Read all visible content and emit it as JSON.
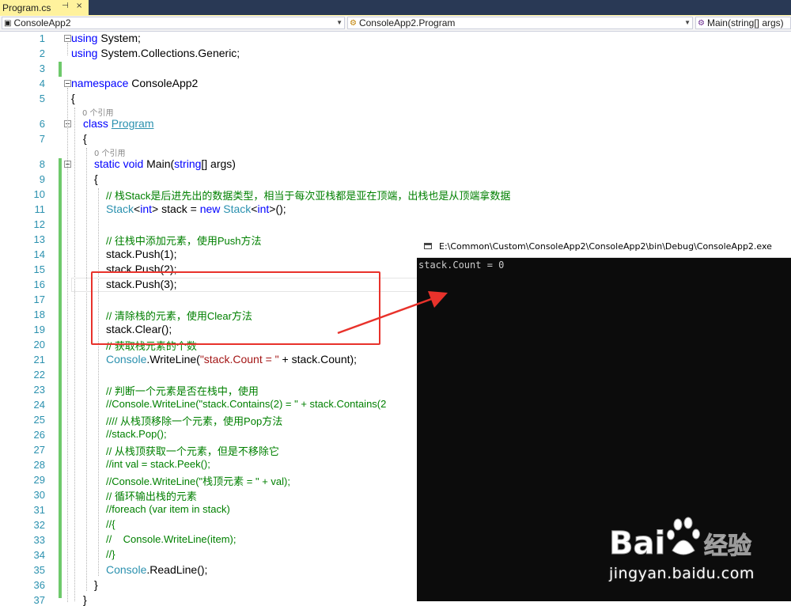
{
  "tab": {
    "title": "Program.cs",
    "pin": "⊣",
    "close": "×"
  },
  "nav": {
    "project": "ConsoleApp2",
    "class": "ConsoleApp2.Program",
    "member": "Main(string[] args)"
  },
  "codelens": {
    "refs": "0 个引用"
  },
  "lines": [
    "using System;",
    "using System.Collections.Generic;",
    "",
    "namespace ConsoleApp2",
    "{",
    "class Program",
    "{",
    "static void Main(string[] args)",
    "{",
    "// 栈Stack是后进先出的数据类型，相当于每次亚栈都是亚在顶端，出栈也是从顶端拿数据",
    "Stack<int> stack = new Stack<int>();",
    "",
    "// 往栈中添加元素，使用Push方法",
    "stack.Push(1);",
    "stack.Push(2);",
    "stack.Push(3);",
    "",
    "// 清除栈的元素，使用Clear方法",
    "stack.Clear();",
    "// 获取栈元素的个数",
    "Console.WriteLine(\"stack.Count = \" + stack.Count);",
    "",
    "// 判断一个元素是否在栈中，使用",
    "//Console.WriteLine(\"stack.Contains(2) = \" + stack.Contains(2",
    "//// 从栈顶移除一个元素，使用Pop方法",
    "//stack.Pop();",
    "// 从栈顶获取一个元素，但是不移除它",
    "//int val = stack.Peek();",
    "//Console.WriteLine(\"栈顶元素 = \" + val);",
    "// 循环输出栈的元素",
    "//foreach (var item in stack)",
    "//{",
    "//    Console.WriteLine(item);",
    "//}",
    "Console.ReadLine();",
    "}",
    "}"
  ],
  "console": {
    "title": "E:\\Common\\Custom\\ConsoleApp2\\ConsoleApp2\\bin\\Debug\\ConsoleApp2.exe",
    "output": "stack.Count = 0"
  },
  "watermark": {
    "brand": "Bai 经验",
    "url": "jingyan.baidu.com"
  },
  "colors": {
    "keyword": "#0000ff",
    "type": "#2b91af",
    "comment": "#008000",
    "string": "#a31515",
    "annotation": "#e8322b"
  }
}
